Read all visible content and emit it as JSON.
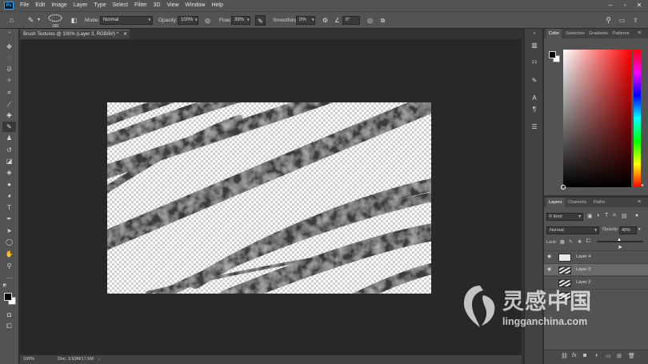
{
  "app": {
    "logo": "Ps"
  },
  "menu": [
    "File",
    "Edit",
    "Image",
    "Layer",
    "Type",
    "Select",
    "Filter",
    "3D",
    "View",
    "Window",
    "Help"
  ],
  "options_bar": {
    "brush_size": "150",
    "mode_label": "Mode:",
    "mode_value": "Normal",
    "opacity_label": "Opacity:",
    "opacity_value": "100%",
    "flow_label": "Flow:",
    "flow_value": "39%",
    "smoothing_label": "Smoothing:",
    "smoothing_value": "0%",
    "angle_value": "0°"
  },
  "document": {
    "tab_title": "Brush Textures @ 100% (Layer 3, RGB/8#) *",
    "zoom": "100%",
    "doc_info": "Doc: 3.93M/17.5M"
  },
  "color_panel": {
    "tabs": [
      "Color",
      "Swatches",
      "Gradients",
      "Patterns"
    ],
    "active_tab": "Color",
    "hue_color": "#ff0000"
  },
  "layers_panel": {
    "tabs": [
      "Layers",
      "Channels",
      "Paths"
    ],
    "filter_kind": "Kind",
    "blend_mode": "Normal",
    "opacity_label": "Opacity:",
    "opacity_value": "48%",
    "lock_label": "Lock:",
    "layers": [
      {
        "name": "Layer 4",
        "visible": true,
        "selected": false
      },
      {
        "name": "Layer 3",
        "visible": true,
        "selected": true
      },
      {
        "name": "Layer 2",
        "visible": false,
        "selected": false
      },
      {
        "name": "Layer 1",
        "visible": false,
        "selected": false
      }
    ]
  },
  "watermark": {
    "title": "灵感中国",
    "url": "lingganchina.com"
  }
}
